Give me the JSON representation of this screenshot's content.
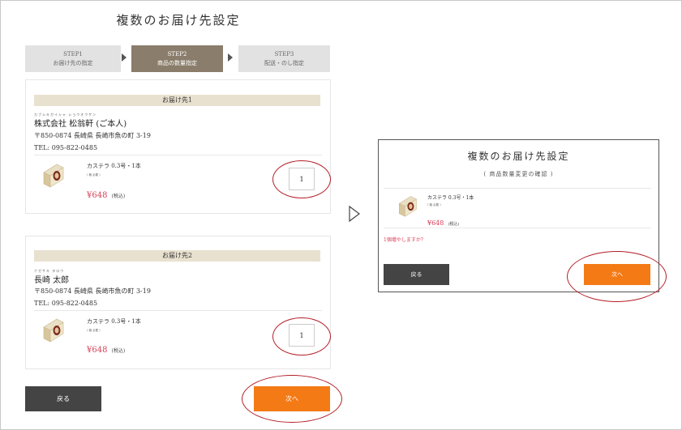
{
  "page_title": "複数のお届け先設定",
  "steps": [
    {
      "label": "STEP1",
      "desc": "お届け先の指定"
    },
    {
      "label": "STEP2",
      "desc": "商品の数量指定"
    },
    {
      "label": "STEP3",
      "desc": "配送・のし指定"
    }
  ],
  "destinations": [
    {
      "header": "お届け先1",
      "ruby": "カブシキガイシャ ショウオウケン",
      "name": "株式会社 松翁軒 (ご本人)",
      "address": "〒850-0874 長崎県 長崎市魚の町 3-19",
      "tel": "TEL: 095-822-0485",
      "product_name": "カステラ 0.3号・1本",
      "product_sub": "( 箱 必要 )",
      "price": "¥648",
      "tax": "(税込)",
      "qty": "1"
    },
    {
      "header": "お届け先2",
      "ruby": "ナガサキ タロウ",
      "name": "長崎 太郎",
      "address": "〒850-0874 長崎県 長崎市魚の町 3-19",
      "tel": "TEL: 095-822-0485",
      "product_name": "カステラ 0.3号・1本",
      "product_sub": "( 箱 必要 )",
      "price": "¥648",
      "tax": "(税込)",
      "qty": "1"
    }
  ],
  "buttons": {
    "back": "戻る",
    "next": "次へ"
  },
  "modal": {
    "title": "複数のお届け先設定",
    "subtitle": "( 商品数量変更の確認 )",
    "product_name": "カステラ 0.3号・1本",
    "product_sub": "( 箱 必要 )",
    "price": "¥648",
    "tax": "(税込)",
    "question": "1個増やしますか？",
    "back": "戻る",
    "next": "次へ"
  },
  "colors": {
    "accent": "#f47a16",
    "price": "#d9415a",
    "step_active": "#8b7d6b",
    "highlight_ring": "#b41e28"
  }
}
